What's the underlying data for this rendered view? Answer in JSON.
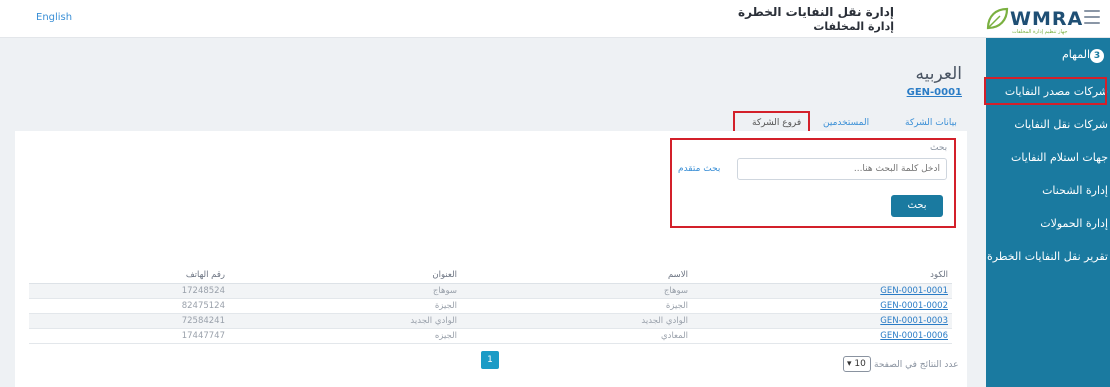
{
  "header": {
    "language": "English",
    "brand": "WMRA",
    "brand_sub": "جهاز تنظيم إدارة المخلفات",
    "title_line1": "إدارة نقل النفايات الخطرة",
    "title_line2": "إدارة المخلفات"
  },
  "sidebar": {
    "items": [
      {
        "label": "المهام",
        "badge": "3"
      },
      {
        "label": "شركات مصدر النفايات"
      },
      {
        "label": "شركات نقل النفايات"
      },
      {
        "label": "جهات استلام النفايات"
      },
      {
        "label": "إدارة الشحنات"
      },
      {
        "label": "إدارة الحمولات"
      },
      {
        "label": "تقرير نقل النفايات الخطرة"
      }
    ]
  },
  "company": {
    "name": "العربيه",
    "code": "GEN-0001"
  },
  "tabs": [
    "بيانات الشركة",
    "المستخدمين",
    "فروع الشركة"
  ],
  "search": {
    "label": "بحث",
    "placeholder": "أدخل كلمة البحث هنا...",
    "advanced": "بحث متقدم",
    "button": "بحث"
  },
  "table": {
    "headers": {
      "code": "الكود",
      "name": "الاسم",
      "address": "العنوان",
      "phone": "رقم الهاتف"
    },
    "rows": [
      {
        "code": "GEN-0001-0001",
        "name": "سوهاج",
        "address": "سوهاج",
        "phone": "17248524"
      },
      {
        "code": "GEN-0001-0002",
        "name": "الجيزة",
        "address": "الجيزة",
        "phone": "82475124"
      },
      {
        "code": "GEN-0001-0003",
        "name": "الوادي الجديد",
        "address": "الوادي الجديد",
        "phone": "72584241"
      },
      {
        "code": "GEN-0001-0006",
        "name": "المعادي",
        "address": "الجيزه",
        "phone": "17447747"
      }
    ]
  },
  "pagination": {
    "current_page": "1",
    "page_size_label": "عدد النتائج في الصفحة",
    "page_size": "10"
  },
  "colors": {
    "sidebar": "#1a7aa0",
    "highlight": "#d3202a",
    "link": "#2a7cc6"
  }
}
